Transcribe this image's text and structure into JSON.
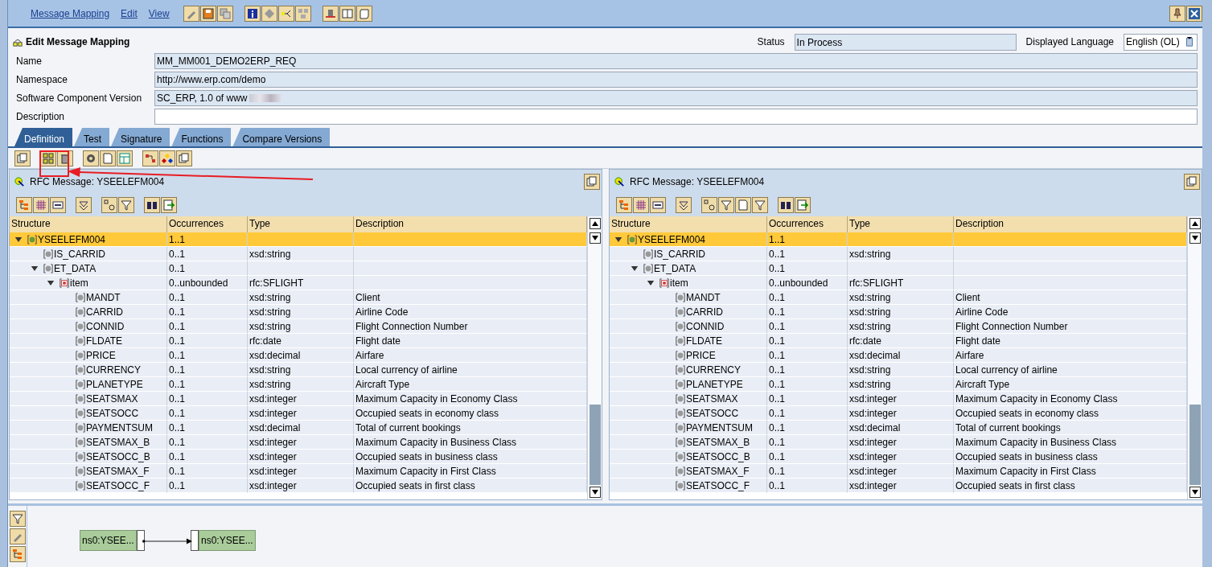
{
  "menu": [
    {
      "label": "Message Mapping"
    },
    {
      "label": "Edit"
    },
    {
      "label": "View"
    }
  ],
  "title": "Edit Message Mapping",
  "status": {
    "label": "Status",
    "value": "In Process"
  },
  "language": {
    "label": "Displayed Language",
    "value": "English (OL)"
  },
  "fields": [
    {
      "label": "Name",
      "value": "MM_MM001_DEMO2ERP_REQ",
      "editable": false
    },
    {
      "label": "Namespace",
      "value": "http://www.erp.com/demo",
      "editable": false
    },
    {
      "label": "Software Component Version",
      "value": "SC_ERP, 1.0 of www",
      "editable": false,
      "blurred": true
    },
    {
      "label": "Description",
      "editable": true
    }
  ],
  "tabs": [
    {
      "label": "Definition",
      "selected": true
    },
    {
      "label": "Test",
      "selected": false
    },
    {
      "label": "Signature",
      "selected": false
    },
    {
      "label": "Functions",
      "selected": false
    },
    {
      "label": "Compare Versions",
      "selected": false
    }
  ],
  "annotation": {
    "highlight_box": true,
    "pointer_arrow": true
  },
  "panels": [
    {
      "title": "RFC Message: YSEELEFM004",
      "columns": [
        "Structure",
        "Occurrences",
        "Type",
        "Description"
      ],
      "tree": [
        {
          "name": "YSEELEFM004",
          "kind": "message",
          "occurrences": "1..1",
          "expanded": true,
          "selected": true,
          "children": [
            {
              "name": "IS_CARRID",
              "kind": "field",
              "occurrences": "0..1",
              "type": "xsd:string",
              "selected": false
            },
            {
              "name": "ET_DATA",
              "kind": "field",
              "occurrences": "0..1",
              "expanded": true,
              "selected": false,
              "children": [
                {
                  "name": "item",
                  "kind": "item",
                  "occurrences": "0..unbounded",
                  "type": "rfc:SFLIGHT",
                  "expanded": true,
                  "selected": false,
                  "children": [
                    {
                      "name": "MANDT",
                      "kind": "field",
                      "occurrences": "0..1",
                      "type": "xsd:string",
                      "description": "Client",
                      "selected": false
                    },
                    {
                      "name": "CARRID",
                      "kind": "field",
                      "occurrences": "0..1",
                      "type": "xsd:string",
                      "description": "Airline Code",
                      "selected": false
                    },
                    {
                      "name": "CONNID",
                      "kind": "field",
                      "occurrences": "0..1",
                      "type": "xsd:string",
                      "description": "Flight Connection Number",
                      "selected": false
                    },
                    {
                      "name": "FLDATE",
                      "kind": "field",
                      "occurrences": "0..1",
                      "type": "rfc:date",
                      "description": "Flight date",
                      "selected": false
                    },
                    {
                      "name": "PRICE",
                      "kind": "field",
                      "occurrences": "0..1",
                      "type": "xsd:decimal",
                      "description": "Airfare",
                      "selected": false
                    },
                    {
                      "name": "CURRENCY",
                      "kind": "field",
                      "occurrences": "0..1",
                      "type": "xsd:string",
                      "description": "Local currency of airline",
                      "selected": false
                    },
                    {
                      "name": "PLANETYPE",
                      "kind": "field",
                      "occurrences": "0..1",
                      "type": "xsd:string",
                      "description": "Aircraft Type",
                      "selected": false
                    },
                    {
                      "name": "SEATSMAX",
                      "kind": "field",
                      "occurrences": "0..1",
                      "type": "xsd:integer",
                      "description": "Maximum Capacity in Economy Class",
                      "selected": false
                    },
                    {
                      "name": "SEATSOCC",
                      "kind": "field",
                      "occurrences": "0..1",
                      "type": "xsd:integer",
                      "description": "Occupied seats in economy class",
                      "selected": false
                    },
                    {
                      "name": "PAYMENTSUM",
                      "kind": "field",
                      "occurrences": "0..1",
                      "type": "xsd:decimal",
                      "description": "Total of current bookings",
                      "selected": false
                    },
                    {
                      "name": "SEATSMAX_B",
                      "kind": "field",
                      "occurrences": "0..1",
                      "type": "xsd:integer",
                      "description": "Maximum Capacity in Business Class",
                      "selected": false
                    },
                    {
                      "name": "SEATSOCC_B",
                      "kind": "field",
                      "occurrences": "0..1",
                      "type": "xsd:integer",
                      "description": "Occupied seats in business class",
                      "selected": false
                    },
                    {
                      "name": "SEATSMAX_F",
                      "kind": "field",
                      "occurrences": "0..1",
                      "type": "xsd:integer",
                      "description": "Maximum Capacity in First Class",
                      "selected": false
                    },
                    {
                      "name": "SEATSOCC_F",
                      "kind": "field",
                      "occurrences": "0..1",
                      "type": "xsd:integer",
                      "description": "Occupied seats in first class",
                      "selected": false
                    }
                  ]
                }
              ]
            }
          ]
        }
      ]
    },
    {
      "title": "RFC Message: YSEELEFM004",
      "columns": [
        "Structure",
        "Occurrences",
        "Type",
        "Description"
      ],
      "tree": [
        {
          "name": "YSEELEFM004",
          "kind": "message",
          "occurrences": "1..1",
          "expanded": true,
          "selected": true,
          "children": [
            {
              "name": "IS_CARRID",
              "kind": "field",
              "occurrences": "0..1",
              "type": "xsd:string",
              "selected": false
            },
            {
              "name": "ET_DATA",
              "kind": "field",
              "occurrences": "0..1",
              "expanded": true,
              "selected": false,
              "children": [
                {
                  "name": "item",
                  "kind": "item",
                  "occurrences": "0..unbounded",
                  "type": "rfc:SFLIGHT",
                  "expanded": true,
                  "selected": false,
                  "children": [
                    {
                      "name": "MANDT",
                      "kind": "field",
                      "occurrences": "0..1",
                      "type": "xsd:string",
                      "description": "Client",
                      "selected": false
                    },
                    {
                      "name": "CARRID",
                      "kind": "field",
                      "occurrences": "0..1",
                      "type": "xsd:string",
                      "description": "Airline Code",
                      "selected": false
                    },
                    {
                      "name": "CONNID",
                      "kind": "field",
                      "occurrences": "0..1",
                      "type": "xsd:string",
                      "description": "Flight Connection Number",
                      "selected": false
                    },
                    {
                      "name": "FLDATE",
                      "kind": "field",
                      "occurrences": "0..1",
                      "type": "rfc:date",
                      "description": "Flight date",
                      "selected": false
                    },
                    {
                      "name": "PRICE",
                      "kind": "field",
                      "occurrences": "0..1",
                      "type": "xsd:decimal",
                      "description": "Airfare",
                      "selected": false
                    },
                    {
                      "name": "CURRENCY",
                      "kind": "field",
                      "occurrences": "0..1",
                      "type": "xsd:string",
                      "description": "Local currency of airline",
                      "selected": false
                    },
                    {
                      "name": "PLANETYPE",
                      "kind": "field",
                      "occurrences": "0..1",
                      "type": "xsd:string",
                      "description": "Aircraft Type",
                      "selected": false
                    },
                    {
                      "name": "SEATSMAX",
                      "kind": "field",
                      "occurrences": "0..1",
                      "type": "xsd:integer",
                      "description": "Maximum Capacity in Economy Class",
                      "selected": false
                    },
                    {
                      "name": "SEATSOCC",
                      "kind": "field",
                      "occurrences": "0..1",
                      "type": "xsd:integer",
                      "description": "Occupied seats in economy class",
                      "selected": false
                    },
                    {
                      "name": "PAYMENTSUM",
                      "kind": "field",
                      "occurrences": "0..1",
                      "type": "xsd:decimal",
                      "description": "Total of current bookings",
                      "selected": false
                    },
                    {
                      "name": "SEATSMAX_B",
                      "kind": "field",
                      "occurrences": "0..1",
                      "type": "xsd:integer",
                      "description": "Maximum Capacity in Business Class",
                      "selected": false
                    },
                    {
                      "name": "SEATSOCC_B",
                      "kind": "field",
                      "occurrences": "0..1",
                      "type": "xsd:integer",
                      "description": "Occupied seats in business class",
                      "selected": false
                    },
                    {
                      "name": "SEATSMAX_F",
                      "kind": "field",
                      "occurrences": "0..1",
                      "type": "xsd:integer",
                      "description": "Maximum Capacity in First Class",
                      "selected": false
                    },
                    {
                      "name": "SEATSOCC_F",
                      "kind": "field",
                      "occurrences": "0..1",
                      "type": "xsd:integer",
                      "description": "Occupied seats in first class",
                      "selected": false
                    }
                  ]
                }
              ]
            }
          ]
        }
      ]
    }
  ],
  "diagram": {
    "nodes": [
      {
        "label": "ns0:YSEE..."
      },
      {
        "label": "ns0:YSEE..."
      }
    ]
  }
}
